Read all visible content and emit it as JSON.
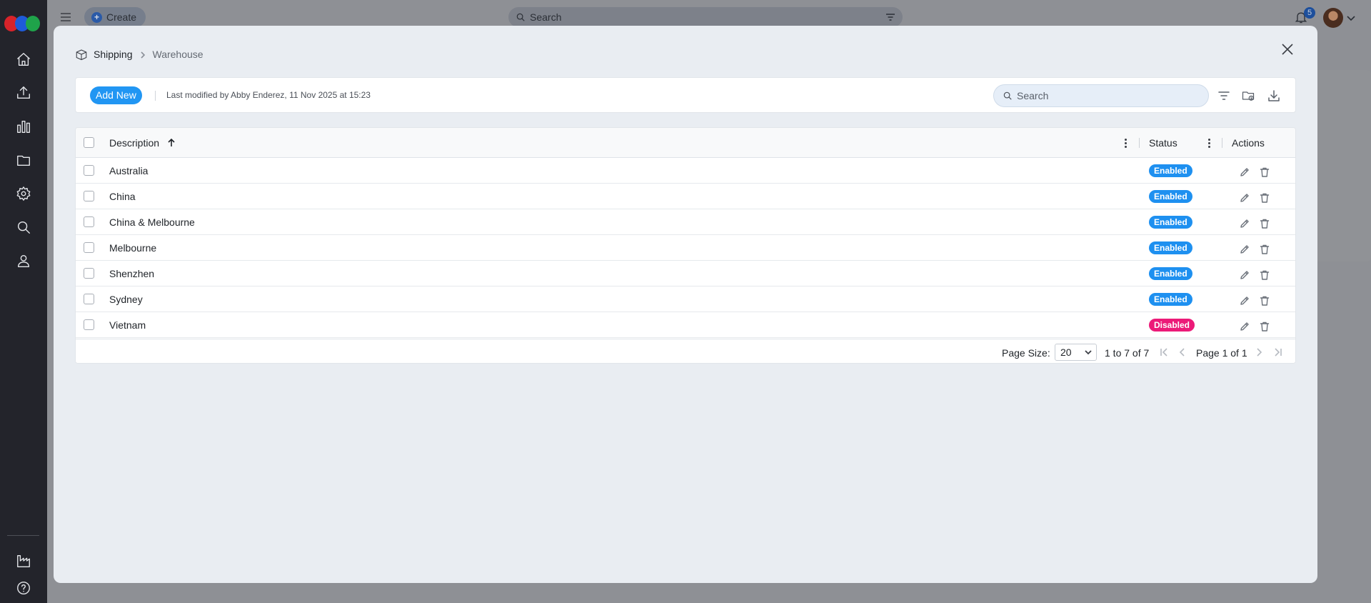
{
  "topbar": {
    "create_label": "Create",
    "search_placeholder": "Search",
    "notification_count": "5"
  },
  "sidebar": {
    "items": [
      {
        "name": "home-icon"
      },
      {
        "name": "upload-icon"
      },
      {
        "name": "bar-chart-icon"
      },
      {
        "name": "folder-icon"
      },
      {
        "name": "gear-icon"
      },
      {
        "name": "search-icon"
      },
      {
        "name": "user-icon"
      },
      {
        "name": "factory-icon"
      },
      {
        "name": "help-icon"
      }
    ]
  },
  "modal": {
    "breadcrumb": {
      "parent": "Shipping",
      "current": "Warehouse"
    },
    "toolbar": {
      "add_new_label": "Add New",
      "last_modified": "Last modified by Abby Enderez, 11 Nov 2025 at 15:23",
      "search_placeholder": "Search"
    },
    "grid": {
      "columns": {
        "description": "Description",
        "status": "Status",
        "actions": "Actions"
      },
      "rows": [
        {
          "description": "Australia",
          "status": "Enabled"
        },
        {
          "description": "China",
          "status": "Enabled"
        },
        {
          "description": "China & Melbourne",
          "status": "Enabled"
        },
        {
          "description": "Melbourne",
          "status": "Enabled"
        },
        {
          "description": "Shenzhen",
          "status": "Enabled"
        },
        {
          "description": "Sydney",
          "status": "Enabled"
        },
        {
          "description": "Vietnam",
          "status": "Disabled"
        }
      ]
    },
    "pager": {
      "page_size_label": "Page Size:",
      "page_size_value": "20",
      "range": "1 to 7 of 7",
      "page_info": "Page 1 of 1"
    }
  },
  "colors": {
    "accent": "#2196f3",
    "enabled_badge": "#1e90f0",
    "disabled_badge": "#ec1a78",
    "sidebar_bg": "#23242b"
  }
}
